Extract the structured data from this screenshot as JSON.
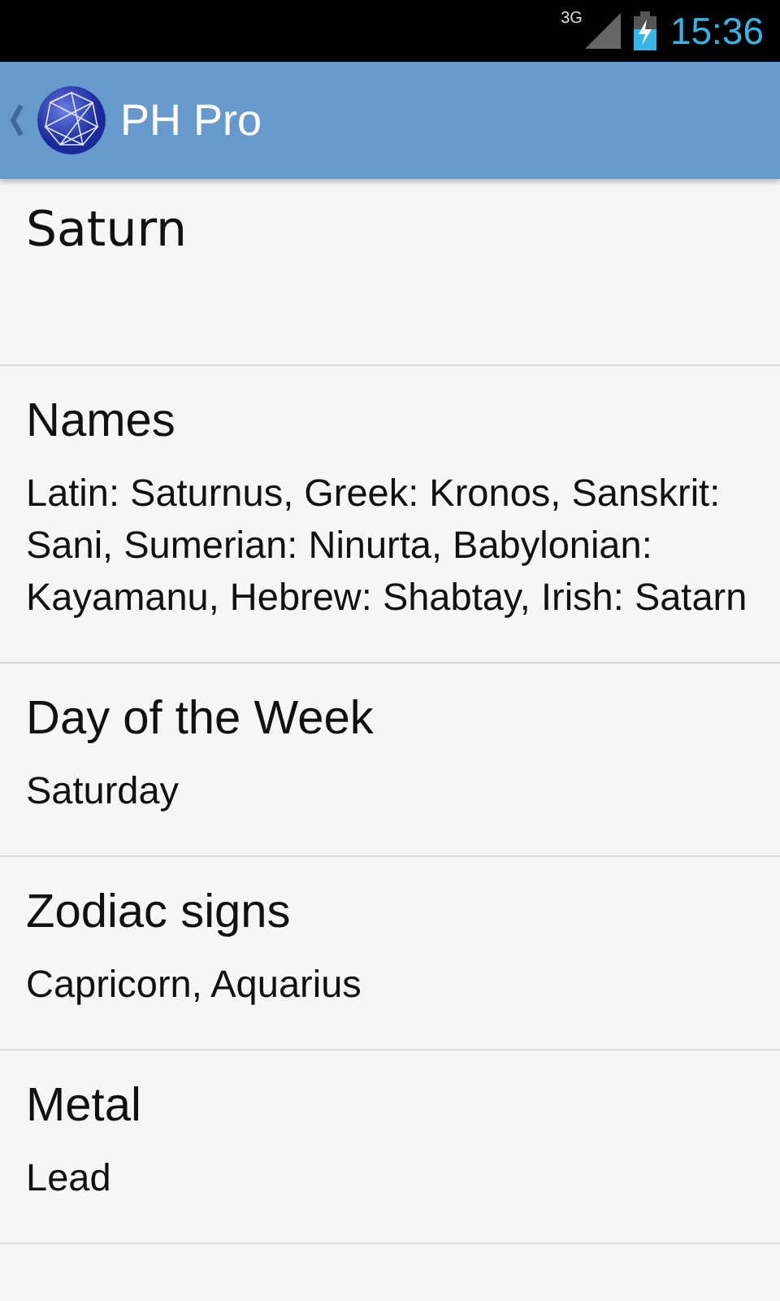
{
  "status_bar": {
    "network": "3G",
    "time": "15:36"
  },
  "action_bar": {
    "title": "PH Pro"
  },
  "title": "Saturn",
  "sections": [
    {
      "heading": "Names",
      "value": "Latin: Saturnus, Greek: Kronos, Sanskrit: Sani, Sumerian: Ninurta, Babylonian: Kayamanu, Hebrew: Shabtay, Irish: Satarn"
    },
    {
      "heading": "Day of the Week",
      "value": "Saturday"
    },
    {
      "heading": "Zodiac signs",
      "value": "Capricorn, Aquarius"
    },
    {
      "heading": "Metal",
      "value": "Lead"
    }
  ]
}
